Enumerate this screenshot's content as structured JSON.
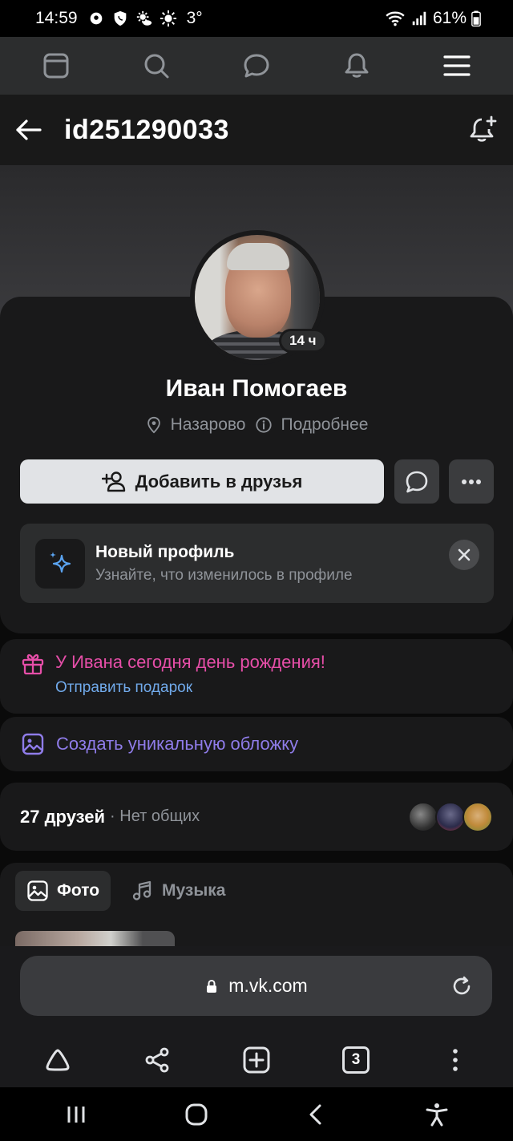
{
  "status_bar": {
    "time": "14:59",
    "temperature": "3°",
    "battery": "61%"
  },
  "top_nav": {
    "items": [
      "window-icon",
      "search-icon",
      "message-icon",
      "bell-icon",
      "menu-icon"
    ]
  },
  "header": {
    "title": "id251290033"
  },
  "profile": {
    "online_badge": "14 ч",
    "name": "Иван Помогаев",
    "city": "Назарово",
    "details_link": "Подробнее",
    "add_friend_label": "Добавить в друзья"
  },
  "new_profile_banner": {
    "title": "Новый профиль",
    "subtitle": "Узнайте, что изменилось в профиле"
  },
  "birthday": {
    "title": "У Ивана сегодня день рождения!",
    "link": "Отправить подарок"
  },
  "cover_cta": {
    "label": "Создать уникальную обложку"
  },
  "friends": {
    "count": "27 друзей",
    "mutual": "· Нет общих"
  },
  "media_tabs": {
    "photo": "Фото",
    "music": "Музыка"
  },
  "browser": {
    "url": "m.vk.com",
    "tabs_count": "3"
  },
  "colors": {
    "accent_blue": "#71aaeb",
    "birthday_pink": "#e64ea8",
    "cover_purple": "#8f7ce9",
    "card_bg": "#19191a"
  }
}
